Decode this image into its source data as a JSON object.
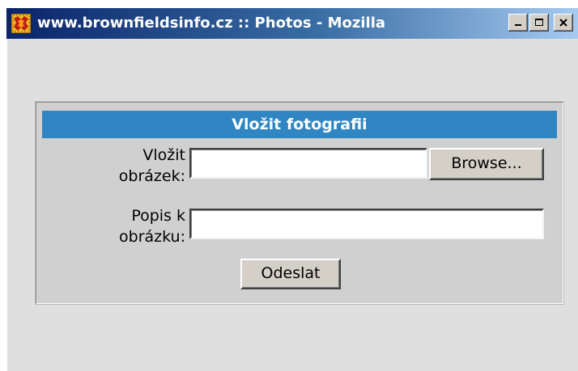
{
  "window": {
    "title": "www.brownfieldsinfo.cz :: Photos - Mozilla",
    "app_icon": "mozilla-app-icon",
    "controls": [
      "minimize-icon",
      "maximize-icon",
      "close-icon"
    ]
  },
  "form": {
    "heading": "Vložit fotografii",
    "image_label_line1": "Vložit",
    "image_label_line2": "obrázek:",
    "file_value": "",
    "browse_label": "Browse...",
    "desc_label_line1": "Popis k",
    "desc_label_line2": "obrázku:",
    "desc_value": "",
    "submit_label": "Odeslat"
  },
  "colors": {
    "header_bg": "#2f86c2",
    "window_bg": "#dfdfdf",
    "panel_bg": "#d0d0d0"
  }
}
